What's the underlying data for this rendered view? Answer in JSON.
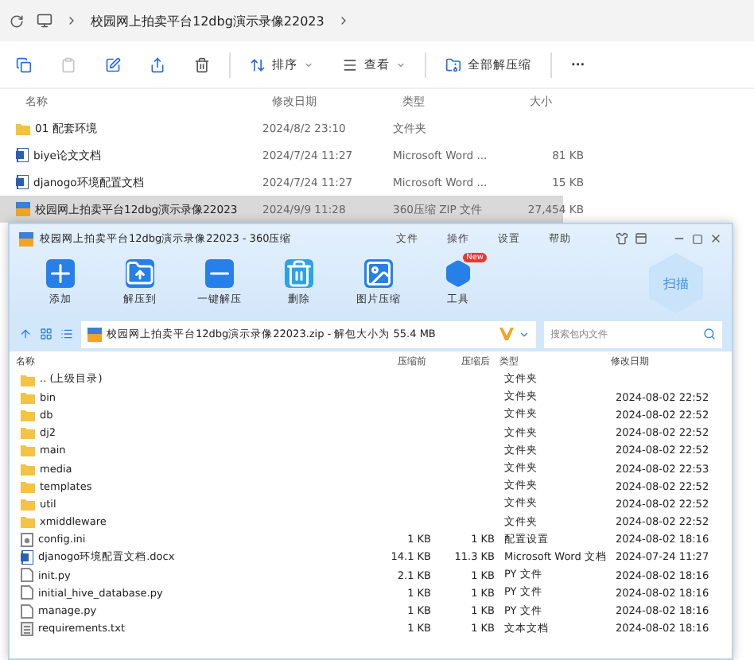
{
  "explorer": {
    "breadcrumb": [
      "校园网上拍卖平台12dbg演示录像22023"
    ],
    "toolbar": [
      {
        "kind": "icon",
        "disabled": false
      },
      {
        "kind": "icon",
        "disabled": true
      },
      {
        "kind": "icon",
        "disabled": false
      },
      {
        "kind": "icon",
        "disabled": false
      },
      {
        "kind": "icon",
        "disabled": false
      },
      {
        "kind": "menu",
        "label": "排序"
      },
      {
        "kind": "menu",
        "label": "查看"
      },
      {
        "kind": "action",
        "label": "全部解压缩"
      },
      {
        "kind": "more",
        "label": "···"
      }
    ],
    "columns": [
      "名称",
      "修改日期",
      "类型",
      "大小"
    ],
    "rows": [
      {
        "kind": "folder",
        "name": "01 配套环境",
        "date": "2024/8/2 23:10",
        "type": "文件夹",
        "size": "",
        "selected": false
      },
      {
        "kind": "word",
        "name": "biye论文文档",
        "date": "2024/7/24 11:27",
        "type": "Microsoft Word ...",
        "size": "81 KB",
        "selected": false
      },
      {
        "kind": "word",
        "name": "djanogo环境配置文档",
        "date": "2024/7/24 11:27",
        "type": "Microsoft Word ...",
        "size": "15 KB",
        "selected": false
      },
      {
        "kind": "zip",
        "name": "校园网上拍卖平台12dbg演示录像22023",
        "date": "2024/9/9 11:28",
        "type": "360压缩 ZIP 文件",
        "size": "27,454 KB",
        "selected": true
      }
    ]
  },
  "zip_window": {
    "title": "校园网上拍卖平台12dbg演示录像22023 - 360压缩",
    "menu": [
      "文件",
      "操作",
      "设置",
      "帮助"
    ],
    "tools": [
      {
        "label": "添加"
      },
      {
        "label": "解压到"
      },
      {
        "label": "一键解压"
      },
      {
        "label": "删除"
      },
      {
        "label": "图片压缩"
      },
      {
        "label": "工具",
        "badge": "New"
      }
    ],
    "scan_label": "扫描",
    "path": "校园网上拍卖平台12dbg演示录像22023.zip - 解包大小为 55.4 MB",
    "search": {
      "placeholder": "搜索包内文件"
    },
    "columns": [
      "名称",
      "压缩前",
      "压缩后",
      "类型",
      "修改日期"
    ],
    "rows": [
      {
        "kind": "folder",
        "name": ".. (上级目录)",
        "before": "",
        "after": "",
        "type": "文件夹",
        "date": ""
      },
      {
        "kind": "folder",
        "name": "bin",
        "before": "",
        "after": "",
        "type": "文件夹",
        "date": "2024-08-02 22:52"
      },
      {
        "kind": "folder",
        "name": "db",
        "before": "",
        "after": "",
        "type": "文件夹",
        "date": "2024-08-02 22:52"
      },
      {
        "kind": "folder",
        "name": "dj2",
        "before": "",
        "after": "",
        "type": "文件夹",
        "date": "2024-08-02 22:52"
      },
      {
        "kind": "folder",
        "name": "main",
        "before": "",
        "after": "",
        "type": "文件夹",
        "date": "2024-08-02 22:52"
      },
      {
        "kind": "folder",
        "name": "media",
        "before": "",
        "after": "",
        "type": "文件夹",
        "date": "2024-08-02 22:53"
      },
      {
        "kind": "folder",
        "name": "templates",
        "before": "",
        "after": "",
        "type": "文件夹",
        "date": "2024-08-02 22:52"
      },
      {
        "kind": "folder",
        "name": "util",
        "before": "",
        "after": "",
        "type": "文件夹",
        "date": "2024-08-02 22:52"
      },
      {
        "kind": "folder",
        "name": "xmiddleware",
        "before": "",
        "after": "",
        "type": "文件夹",
        "date": "2024-08-02 22:52"
      },
      {
        "kind": "settings",
        "name": "config.ini",
        "before": "1 KB",
        "after": "1 KB",
        "type": "配置设置",
        "date": "2024-08-02 18:16"
      },
      {
        "kind": "word",
        "name": "djanogo环境配置文档.docx",
        "before": "14.1 KB",
        "after": "11.3 KB",
        "type": "Microsoft Word 文档",
        "date": "2024-07-24 11:27"
      },
      {
        "kind": "file",
        "name": "init.py",
        "before": "2.1 KB",
        "after": "1 KB",
        "type": "PY 文件",
        "date": "2024-08-02 18:16"
      },
      {
        "kind": "file",
        "name": "initial_hive_database.py",
        "before": "1 KB",
        "after": "1 KB",
        "type": "PY 文件",
        "date": "2024-08-02 18:16"
      },
      {
        "kind": "file",
        "name": "manage.py",
        "before": "1 KB",
        "after": "1 KB",
        "type": "PY 文件",
        "date": "2024-08-02 18:16"
      },
      {
        "kind": "text",
        "name": "requirements.txt",
        "before": "1 KB",
        "after": "1 KB",
        "type": "文本文档",
        "date": "2024-08-02 18:16"
      }
    ]
  }
}
